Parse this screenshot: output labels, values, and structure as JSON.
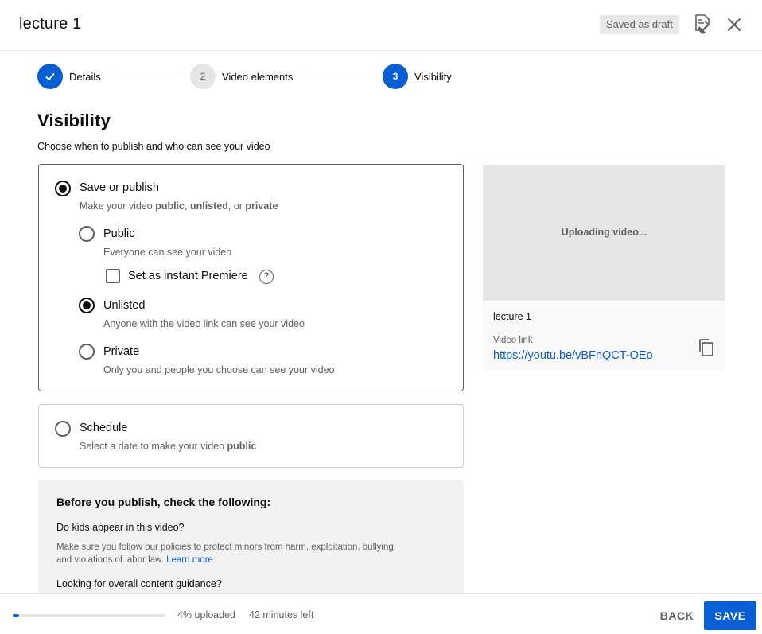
{
  "header": {
    "title": "lecture 1",
    "draft_badge": "Saved as draft",
    "feedback_icon": "feedback-icon",
    "close_icon": "close-icon"
  },
  "stepper": {
    "steps": [
      {
        "label": "Details",
        "number": "✓",
        "state": "done"
      },
      {
        "label": "Video elements",
        "number": "2",
        "state": "todo"
      },
      {
        "label": "Visibility",
        "number": "3",
        "state": "active"
      }
    ]
  },
  "visibility": {
    "title": "Visibility",
    "subtitle": "Choose when to publish and who can see your video",
    "save_or_publish": {
      "label": "Save or publish",
      "desc_prefix": "Make your video ",
      "desc_public": "public",
      "desc_sep1": ", ",
      "desc_unlisted": "unlisted",
      "desc_sep2": ", or ",
      "desc_private": "private",
      "selected": true
    },
    "options": [
      {
        "label": "Public",
        "desc": "Everyone can see your video",
        "selected": false
      },
      {
        "label": "Unlisted",
        "desc": "Anyone with the video link can see your video",
        "selected": true
      },
      {
        "label": "Private",
        "desc": "Only you and people you choose can see your video",
        "selected": false
      }
    ],
    "premiere": {
      "label": "Set as instant Premiere",
      "checked": false,
      "help_icon": "help-icon"
    },
    "schedule": {
      "label": "Schedule",
      "desc_prefix": "Select a date to make your video ",
      "desc_bold": "public",
      "selected": false
    }
  },
  "checks": {
    "title": "Before you publish, check the following:",
    "q1": "Do kids appear in this video?",
    "q1_text": "Make sure you follow our policies to protect minors from harm, exploitation, bullying, and violations of labor law.",
    "q1_link": "Learn more",
    "q2": "Looking for overall content guidance?"
  },
  "preview": {
    "status": "Uploading video...",
    "title": "lecture 1",
    "link_label": "Video link",
    "link": "https://youtu.be/vBFnQCT-OEo",
    "copy_icon": "copy-icon"
  },
  "footer": {
    "progress_percent": 4,
    "upload_status": "4% uploaded",
    "time_left": "42 minutes left",
    "back_label": "BACK",
    "save_label": "SAVE"
  },
  "colors": {
    "accent": "#065fd4",
    "text": "#0d0d0d",
    "muted": "#606060"
  }
}
